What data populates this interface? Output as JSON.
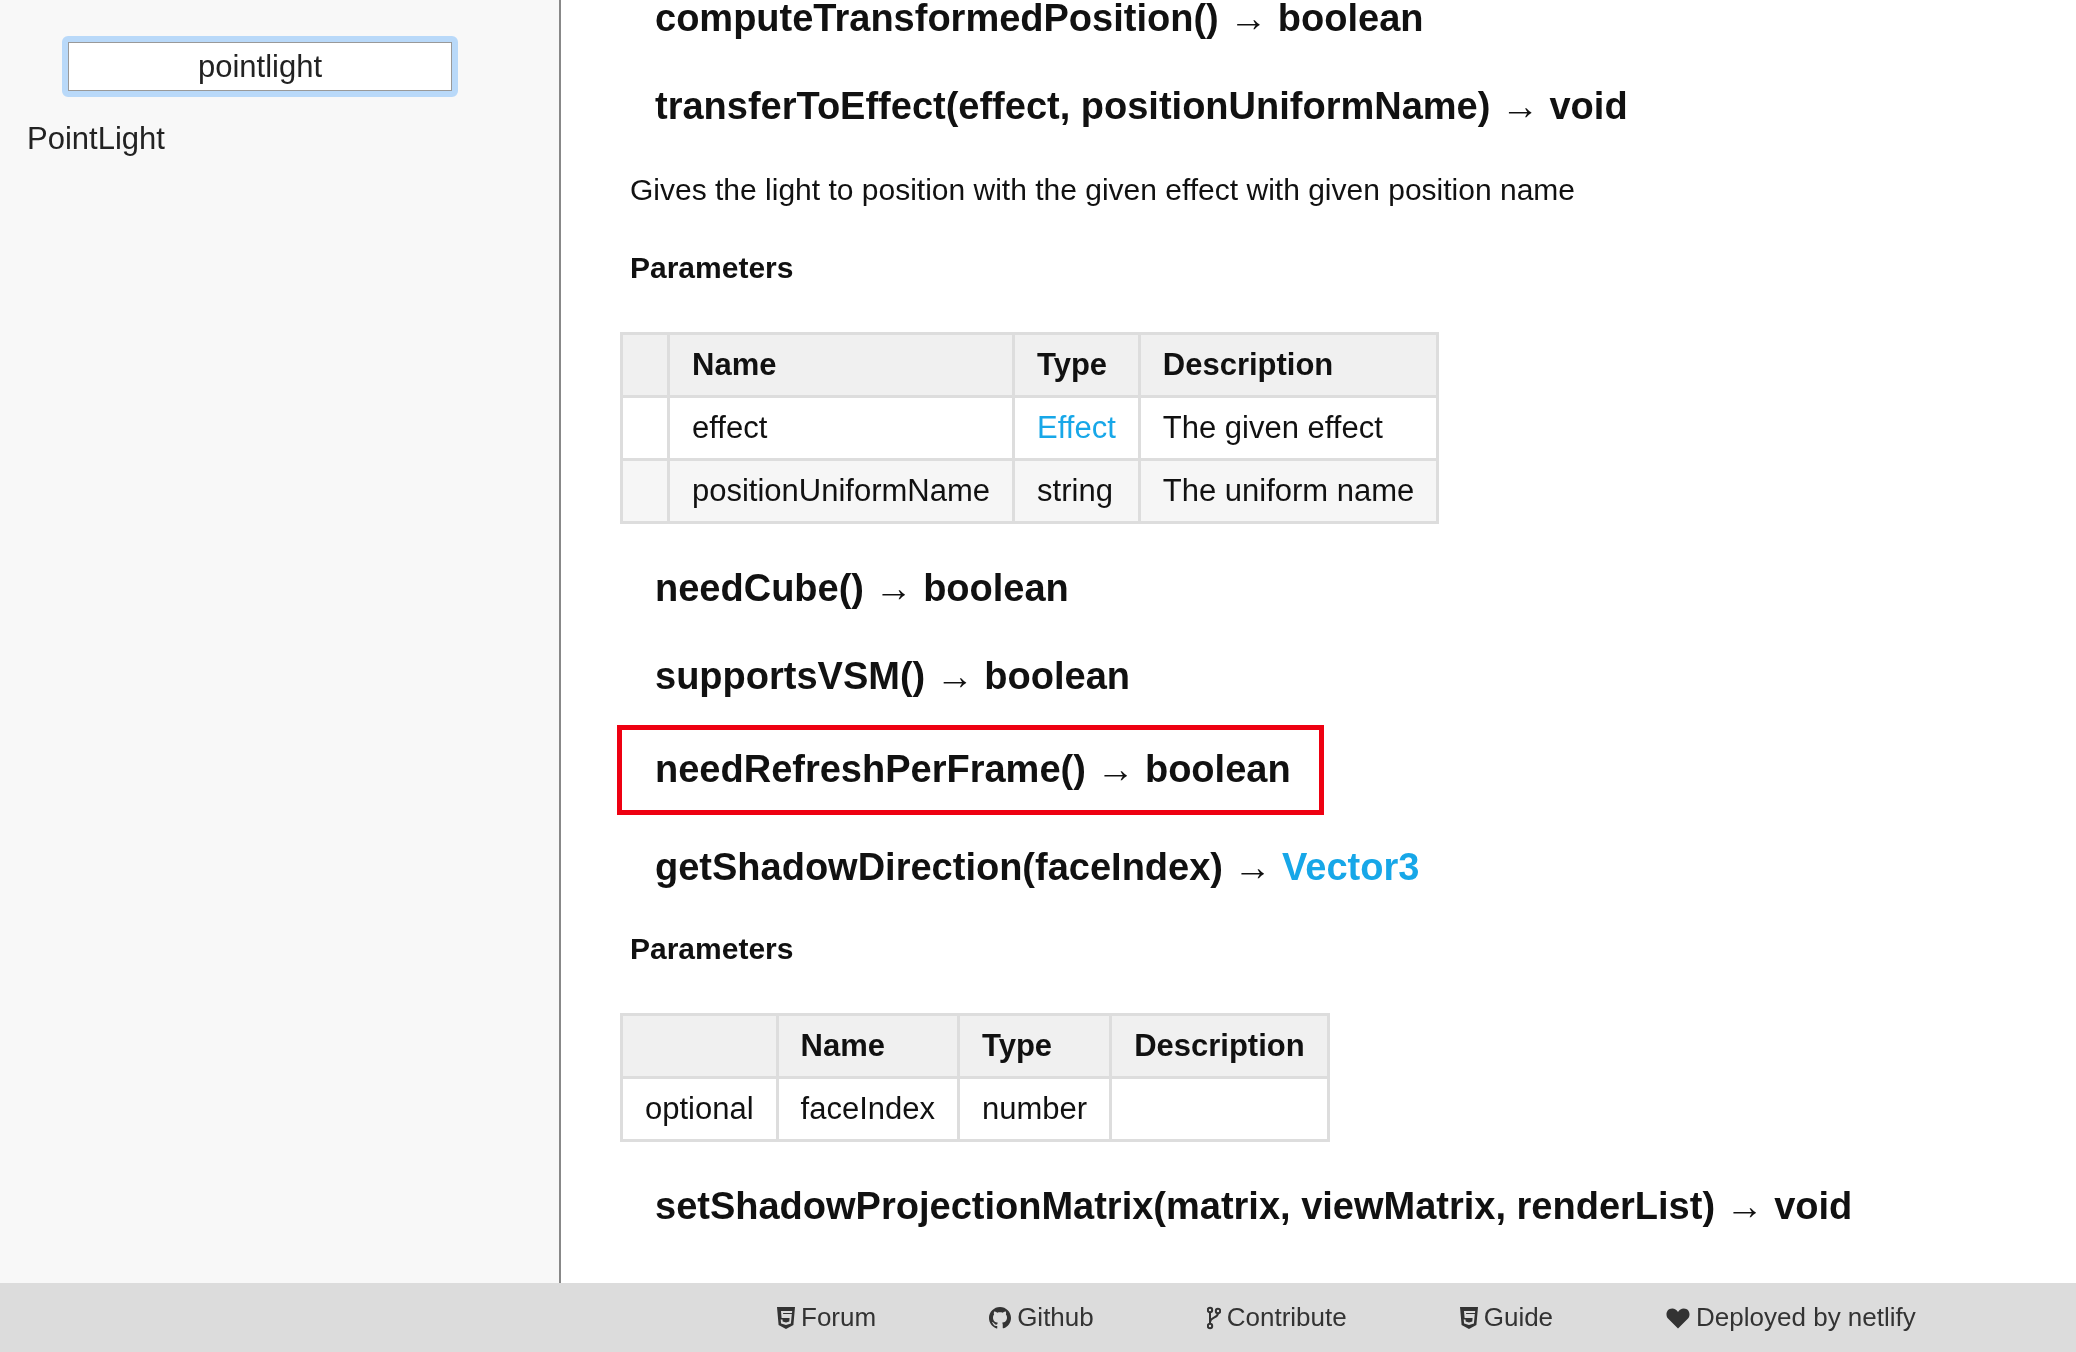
{
  "sidebar": {
    "search": {
      "value": "pointlight",
      "focused": true
    },
    "items": [
      {
        "label": "PointLight"
      }
    ]
  },
  "content": [
    {
      "kind": "method",
      "name": "computeTransformedPosition()",
      "arrow": "→",
      "returns": {
        "text": "boolean",
        "link": false
      },
      "highlighted": false
    },
    {
      "kind": "method",
      "name": "transferToEffect(effect, positionUniformName)",
      "arrow": "→",
      "returns": {
        "text": "void",
        "link": false
      },
      "highlighted": false
    },
    {
      "kind": "paragraph",
      "text": "Gives the light to position with the given effect with given position name"
    },
    {
      "kind": "subheading",
      "text": "Parameters"
    },
    {
      "kind": "table",
      "columns": [
        null,
        "Name",
        "Type",
        "Description"
      ],
      "rows": [
        [
          null,
          {
            "text": "effect",
            "link": false
          },
          {
            "text": "Effect",
            "link": true
          },
          {
            "text": "The given effect",
            "link": false
          }
        ],
        [
          null,
          {
            "text": "positionUniformName",
            "link": false
          },
          {
            "text": "string",
            "link": false
          },
          {
            "text": "The uniform name",
            "link": false
          }
        ]
      ]
    },
    {
      "kind": "method",
      "name": "needCube()",
      "arrow": "→",
      "returns": {
        "text": "boolean",
        "link": false
      },
      "highlighted": false
    },
    {
      "kind": "method",
      "name": "supportsVSM()",
      "arrow": "→",
      "returns": {
        "text": "boolean",
        "link": false
      },
      "highlighted": false
    },
    {
      "kind": "method",
      "name": "needRefreshPerFrame()",
      "arrow": "→",
      "returns": {
        "text": "boolean",
        "link": false
      },
      "highlighted": true
    },
    {
      "kind": "method",
      "name": "getShadowDirection(faceIndex)",
      "arrow": "→",
      "returns": {
        "text": "Vector3",
        "link": true
      },
      "highlighted": false
    },
    {
      "kind": "subheading",
      "text": "Parameters"
    },
    {
      "kind": "table",
      "columns": [
        null,
        "Name",
        "Type",
        "Description"
      ],
      "rows": [
        [
          {
            "text": "optional",
            "link": false
          },
          {
            "text": "faceIndex",
            "link": false
          },
          {
            "text": "number",
            "link": false
          },
          null
        ]
      ]
    },
    {
      "kind": "method",
      "name": "setShadowProjectionMatrix(matrix, viewMatrix, renderList)",
      "arrow": "→",
      "returns": {
        "text": "void",
        "link": false
      },
      "highlighted": false
    }
  ],
  "footer": {
    "links": [
      {
        "label": "Forum"
      },
      {
        "label": "Github"
      },
      {
        "label": "Contribute"
      },
      {
        "label": "Guide"
      },
      {
        "label": "Deployed by netlify"
      }
    ]
  }
}
